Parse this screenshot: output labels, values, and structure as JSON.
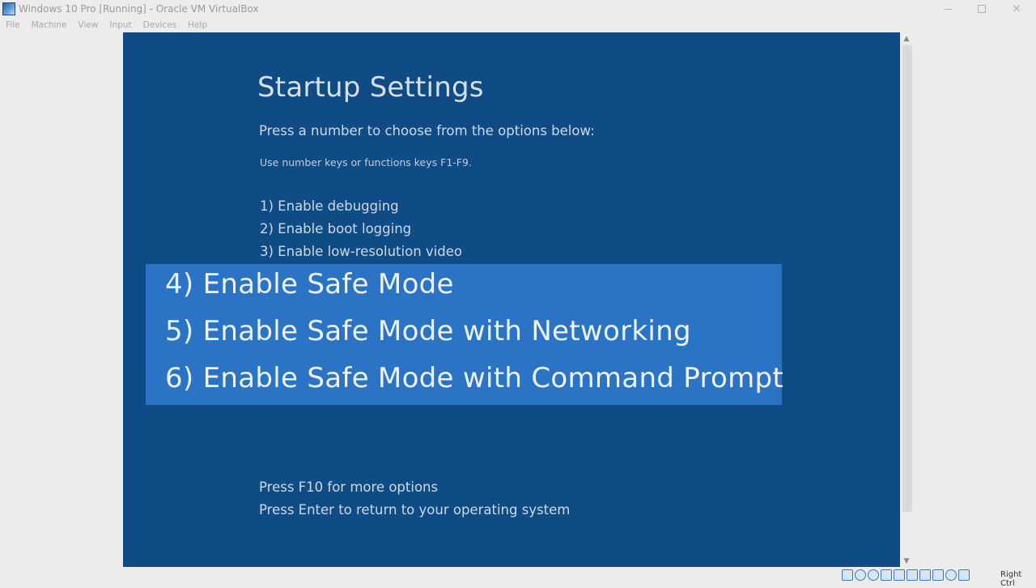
{
  "window": {
    "title": "Windows 10 Pro [Running] - Oracle VM VirtualBox",
    "minimize_glyph": "",
    "close_glyph": "✕"
  },
  "menu": {
    "items": [
      "File",
      "Machine",
      "View",
      "Input",
      "Devices",
      "Help"
    ]
  },
  "screen": {
    "heading": "Startup Settings",
    "subheading": "Press a number to choose from the options below:",
    "hint": "Use number keys or functions keys F1-F9.",
    "options": [
      "1) Enable debugging",
      "2) Enable boot logging",
      "3) Enable low-resolution video"
    ],
    "highlighted_options": [
      "4) Enable Safe Mode",
      "5) Enable Safe Mode with Networking",
      "6) Enable Safe Mode with Command Prompt"
    ],
    "footer": [
      "Press F10 for more options",
      "Press Enter to return to your operating system"
    ],
    "background_color": "#0f4c85",
    "highlight_color": "#2a73c5"
  },
  "scrollbar": {
    "up_glyph": "▲",
    "down_glyph": "▼"
  },
  "statusbar": {
    "icons": [
      "hard-disk-icon",
      "optical-drive-icon",
      "audio-icon",
      "network-icon",
      "usb-icon",
      "shared-folders-icon",
      "display-icon",
      "video-capture-icon",
      "mouse-integration-icon",
      "keyboard-icon"
    ],
    "host_key": "Right Ctrl"
  }
}
